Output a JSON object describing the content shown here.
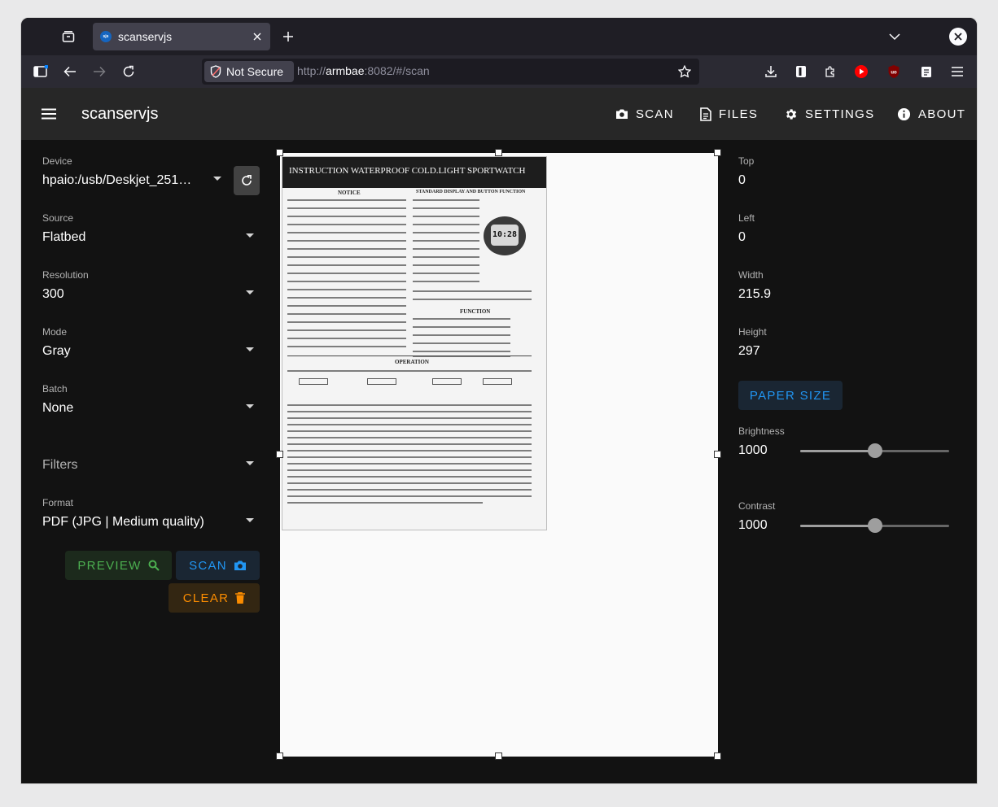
{
  "browser": {
    "tab_title": "scanservjs",
    "favicon_text": "sjs",
    "security_label": "Not Secure",
    "url_prefix": "http://",
    "url_host": "armbae",
    "url_rest": ":8082/#/scan"
  },
  "app": {
    "title": "scanservjs",
    "nav": [
      "SCAN",
      "FILES",
      "SETTINGS",
      "ABOUT"
    ]
  },
  "form": {
    "device_label": "Device",
    "device_value": "hpaio:/usb/Deskjet_251…",
    "source_label": "Source",
    "source_value": "Flatbed",
    "resolution_label": "Resolution",
    "resolution_value": "300",
    "mode_label": "Mode",
    "mode_value": "Gray",
    "batch_label": "Batch",
    "batch_value": "None",
    "filters_label": "Filters",
    "format_label": "Format",
    "format_value": "PDF (JPG | Medium quality)"
  },
  "actions": {
    "preview_label": "PREVIEW",
    "scan_label": "SCAN",
    "clear_label": "CLEAR"
  },
  "crop": {
    "top_label": "Top",
    "top_value": "0",
    "left_label": "Left",
    "left_value": "0",
    "width_label": "Width",
    "width_value": "215.9",
    "height_label": "Height",
    "height_value": "297",
    "paper_size_label": "PAPER SIZE"
  },
  "adjust": {
    "brightness_label": "Brightness",
    "brightness_value": "1000",
    "brightness_fraction": 0.5,
    "contrast_label": "Contrast",
    "contrast_value": "1000",
    "contrast_fraction": 0.5
  },
  "preview_doc": {
    "heading": "INSTRUCTION WATERPROOF COLD.LIGHT SPORTWATCH",
    "notice": "NOTICE",
    "standard_display": "STANDARD DISPLAY AND BUTTON FUNCTION",
    "function": "FUNCTION",
    "operation": "OPERATION",
    "watch_time": "10:28"
  },
  "colors": {
    "background": "#121212",
    "appbar": "#272727",
    "primary": "#2196f3",
    "success": "#4caf50",
    "warning": "#fb8c00"
  }
}
